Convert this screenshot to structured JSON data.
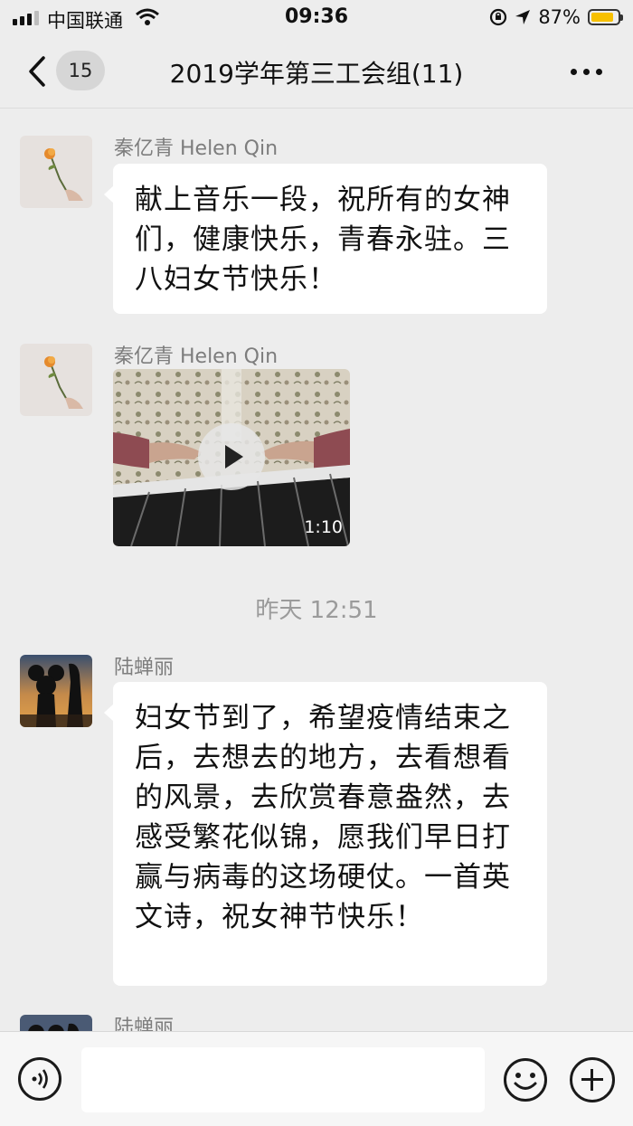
{
  "status_bar": {
    "carrier": "中国联通",
    "time": "09:36",
    "battery_percent": "87%",
    "battery_level": 0.87,
    "icons": [
      "signal-icon",
      "wifi-icon",
      "orientation-lock-icon",
      "location-arrow-icon",
      "battery-icon"
    ]
  },
  "nav": {
    "back_icon": "chevron-left-icon",
    "unread_count": "15",
    "title": "2019学年第三工会组(11)",
    "more_icon": "ellipsis-icon"
  },
  "messages": [
    {
      "sender": "秦亿青 Helen Qin",
      "type": "text",
      "text": "献上音乐一段，祝所有的女神们，健康快乐，青春永驻。三八妇女节快乐！"
    },
    {
      "sender": "秦亿青 Helen Qin",
      "type": "video",
      "duration": "1:10"
    },
    {
      "type": "time",
      "text": "昨天 12:51"
    },
    {
      "sender": "陆蝉丽",
      "type": "text",
      "text": "妇女节到了，希望疫情结束之后，去想去的地方，去看想看的风景，去欣赏春意盎然，去感受繁花似锦，愿我们早日打赢与病毒的这场硬仗。一首英文诗，祝女神节快乐！"
    },
    {
      "sender": "陆蝉丽",
      "type": "partial"
    }
  ],
  "input_bar": {
    "placeholder": "",
    "icons": [
      "voice-icon",
      "emoji-icon",
      "plus-icon"
    ]
  },
  "colors": {
    "background": "#ededed",
    "bubble": "#ffffff",
    "battery": "#f7c000"
  }
}
